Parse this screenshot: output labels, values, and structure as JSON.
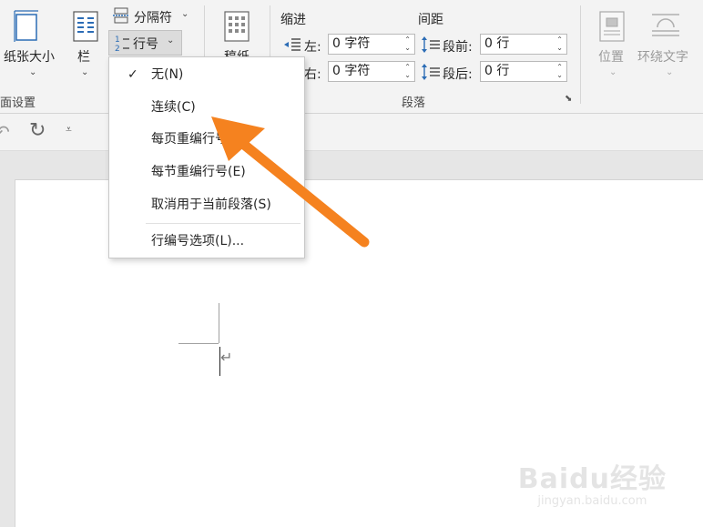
{
  "ribbon": {
    "paper_size_label": "纸张大小",
    "columns_label": "栏",
    "breaks_label": "分隔符",
    "line_numbers_label": "行号",
    "draft_label": "稿纸",
    "page_setup_group": "面设置",
    "indent_title": "缩进",
    "spacing_title": "间距",
    "indent_left_label": "左:",
    "indent_left_value": "0 字符",
    "indent_right_label": "右:",
    "indent_right_value": "0 字符",
    "spacing_before_label": "段前:",
    "spacing_before_value": "0 行",
    "spacing_after_label": "段后:",
    "spacing_after_value": "0 行",
    "paragraph_group": "段落",
    "position_label": "位置",
    "wrap_text_label": "环绕文字"
  },
  "menu": {
    "items": [
      {
        "label": "无(N)",
        "checked": true
      },
      {
        "label": "连续(C)",
        "checked": false
      },
      {
        "label": "每页重编行号(P)",
        "checked": false
      },
      {
        "label": "每节重编行号(E)",
        "checked": false
      },
      {
        "label": "取消用于当前段落(S)",
        "checked": false
      },
      {
        "label": "行编号选项(L)...",
        "checked": false
      }
    ]
  },
  "watermark": {
    "brand": "Baidu经验",
    "url": "jingyan.baidu.com"
  },
  "colors": {
    "accent_arrow": "#f5821f",
    "icon_blue": "#2b6cb5"
  }
}
